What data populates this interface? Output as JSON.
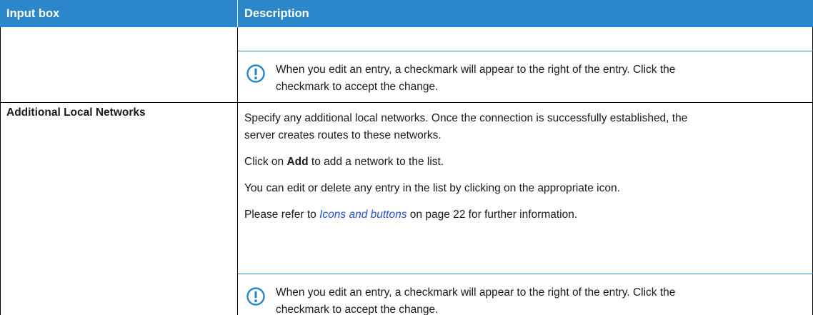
{
  "table": {
    "headers": [
      "Input box",
      "Description"
    ],
    "rows": [
      {
        "label": "",
        "note": {
          "icon": "exclamation-circle-icon",
          "lines": [
            "When you edit an entry, a checkmark will appear to the right of the entry. Click the",
            "checkmark to accept the change."
          ]
        }
      },
      {
        "label": "Additional Local Networks",
        "paragraphs": [
          {
            "lines": [
              "Specify any additional local networks. Once the connection is successfully established, the",
              "server creates routes to these networks."
            ]
          },
          {
            "before": "Click on ",
            "bold": "Add",
            "after": " to add a network to the list."
          },
          {
            "text": "You can edit or delete any entry in the list by clicking on the appropriate icon."
          },
          {
            "before": "Please refer to ",
            "link": "Icons and buttons",
            "after": " on page 22 for further information."
          }
        ],
        "note": {
          "icon": "exclamation-circle-icon",
          "lines": [
            "When you edit an entry, a checkmark will appear to the right of the entry. Click the",
            "checkmark to accept the change."
          ]
        }
      }
    ]
  },
  "colors": {
    "header_bg": "#2b87c9",
    "header_text": "#ffffff",
    "link": "#1f4fd8",
    "note_icon": "#2b87c9"
  }
}
